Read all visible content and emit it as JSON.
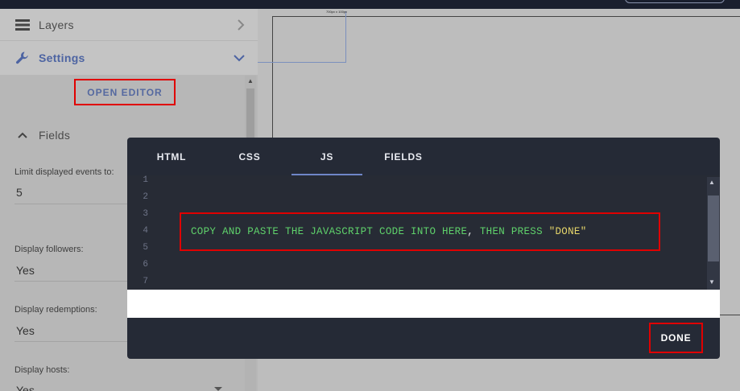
{
  "sidebar": {
    "layers_label": "Layers",
    "settings_label": "Settings",
    "open_editor_label": "OPEN EDITOR",
    "fields_label": "Fields",
    "fields": [
      {
        "label": "Limit displayed events to:",
        "value": "5"
      },
      {
        "label": "Display followers:",
        "value": "Yes"
      },
      {
        "label": "Display redemptions:",
        "value": "Yes"
      },
      {
        "label": "Display hosts:",
        "value": "Yes"
      }
    ]
  },
  "canvas": {
    "size_tag": "700px x 100px"
  },
  "modal": {
    "tabs": [
      {
        "label": "HTML",
        "active": false
      },
      {
        "label": "CSS",
        "active": false
      },
      {
        "label": "JS",
        "active": true
      },
      {
        "label": "FIELDS",
        "active": false
      }
    ],
    "line_numbers": [
      "1",
      "2",
      "3",
      "4",
      "5",
      "6",
      "7"
    ],
    "code_text": {
      "main": "COPY AND PASTE THE JAVASCRIPT CODE INTO HERE",
      "comma": ",",
      "then": " THEN PRESS ",
      "quoted": "\"DONE\""
    },
    "done_label": "DONE"
  },
  "colors": {
    "accent": "#4d64a2",
    "highlight_box": "#e00000",
    "modal_bg": "#252a36",
    "code_green": "#5fd26b"
  }
}
